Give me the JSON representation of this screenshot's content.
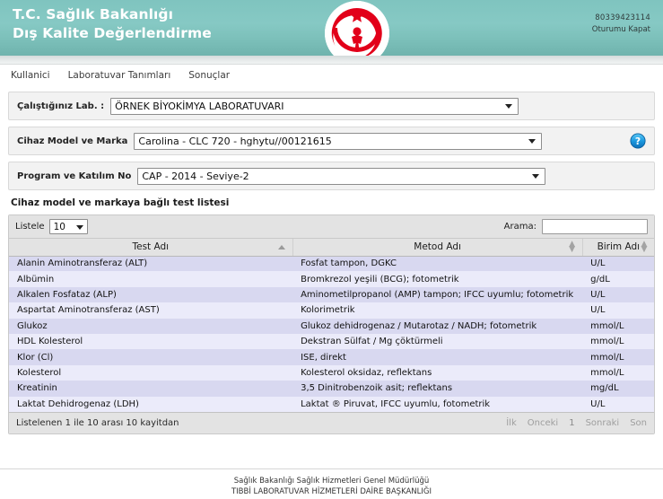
{
  "header": {
    "title_line1": "T.C. Sağlık Bakanlığı",
    "title_line2": "Dış Kalite Değerlendirme",
    "logo_name": "ministry-of-health-logo",
    "user_id": "80339423114",
    "logout_label": "Oturumu Kapat",
    "brand_color": "#7fc4bf",
    "logo_color": "#e2001a"
  },
  "nav": {
    "items": [
      {
        "label": "Kullanici"
      },
      {
        "label": "Laboratuvar Tanımları"
      },
      {
        "label": "Sonuçlar"
      }
    ]
  },
  "form": {
    "lab": {
      "label": "Çalıştığınız Lab. :",
      "value": "ÖRNEK BİYOKİMYA LABORATUVARI"
    },
    "device": {
      "label": "Cihaz Model ve Marka",
      "value": "Carolina - CLC 720 - hghytu//00121615",
      "help_icon": "question-mark-icon"
    },
    "program": {
      "label": "Program ve Katılım No",
      "value": "CAP - 2014 - Seviye-2"
    }
  },
  "section": {
    "title": "Cihaz model ve markaya bağlı test listesi"
  },
  "toolbar": {
    "listele_label": "Listele",
    "page_size": "10",
    "search_label": "Arama:",
    "search_value": "",
    "search_placeholder": ""
  },
  "table": {
    "columns": [
      {
        "label": "Test Adı",
        "sort": "asc"
      },
      {
        "label": "Metod Adı",
        "sort": "none"
      },
      {
        "label": "Birim Adı",
        "sort": "none"
      }
    ],
    "rows": [
      {
        "test": "Alanin Aminotransferaz (ALT)",
        "method": "Fosfat tampon, DGKC",
        "unit": "U/L"
      },
      {
        "test": "Albümin",
        "method": "Bromkrezol yeşili (BCG); fotometrik",
        "unit": "g/dL"
      },
      {
        "test": "Alkalen Fosfataz (ALP)",
        "method": "Aminometilpropanol (AMP) tampon; IFCC uyumlu; fotometrik",
        "unit": "U/L"
      },
      {
        "test": "Aspartat Aminotransferaz (AST)",
        "method": "Kolorimetrik",
        "unit": "U/L"
      },
      {
        "test": "Glukoz",
        "method": "Glukoz dehidrogenaz / Mutarotaz / NADH; fotometrik",
        "unit": "mmol/L"
      },
      {
        "test": "HDL Kolesterol",
        "method": "Dekstran Sülfat / Mg çöktürmeli",
        "unit": "mmol/L"
      },
      {
        "test": "Klor (Cl)",
        "method": "ISE, direkt",
        "unit": "mmol/L"
      },
      {
        "test": "Kolesterol",
        "method": "Kolesterol oksidaz, reflektans",
        "unit": "mmol/L"
      },
      {
        "test": "Kreatinin",
        "method": "3,5 Dinitrobenzoik asit; reflektans",
        "unit": "mg/dL"
      },
      {
        "test": "Laktat Dehidrogenaz (LDH)",
        "method": "Laktat ® Piruvat, IFCC uyumlu, fotometrik",
        "unit": "U/L"
      }
    ]
  },
  "table_footer": {
    "info": "Listelenen 1 ile 10 arası 10 kayitdan",
    "pager": [
      {
        "label": "İlk",
        "state": "disabled"
      },
      {
        "label": "Onceki",
        "state": "disabled"
      },
      {
        "label": "1",
        "state": "current"
      },
      {
        "label": "Sonraki",
        "state": "disabled"
      },
      {
        "label": "Son",
        "state": "disabled"
      }
    ]
  },
  "footer": {
    "line1": "Sağlık Bakanlığı Sağlık Hizmetleri Genel Müdürlüğü",
    "line2": "TIBBİ LABORATUVAR HİZMETLERİ DAİRE BAŞKANLIĞI"
  }
}
